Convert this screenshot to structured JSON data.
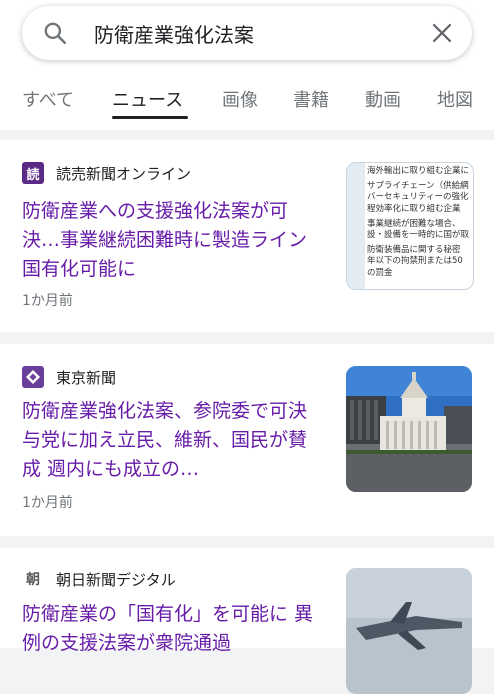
{
  "search": {
    "query": "防衛産業強化法案"
  },
  "tabs": [
    {
      "label": "すべて"
    },
    {
      "label": "ニュース"
    },
    {
      "label": "画像"
    },
    {
      "label": "書籍"
    },
    {
      "label": "動画"
    },
    {
      "label": "地図"
    }
  ],
  "active_tab": "ニュース",
  "results": [
    {
      "source": "読売新聞オンライン",
      "logo_text": "読",
      "headline": "防衛産業への支援強化法案が可決…事業継続困難時に製造ライン国有化可能に",
      "age": "1か月前",
      "thumb_lines": [
        "海外輸出に取り組む企業に",
        "サプライチェーン（供給網",
        "バーセキュリティーの強化",
        "程効率化に取り組む企業",
        "事業継続が困難な場合、",
        "設・設備を一時的に国が取",
        "防衛装備品に関する秘密",
        "年以下の拘禁刑または50",
        "の罰金"
      ]
    },
    {
      "source": "東京新聞",
      "headline": "防衛産業強化法案、参院委で可決 与党に加え立民、維新、国民が賛成 週内にも成立の…",
      "age": "1か月前"
    },
    {
      "source": "朝日新聞デジタル",
      "logo_text": "朝",
      "headline": "防衛産業の「国有化」を可能に 異例の支援法案が衆院通過"
    }
  ],
  "colors": {
    "visited_link": "#681da8",
    "meta_text": "#70757a",
    "page_bg": "#f1f3f4",
    "yomiuri_logo": "#5b2a86",
    "tokyo_logo": "#6a3f9c"
  }
}
